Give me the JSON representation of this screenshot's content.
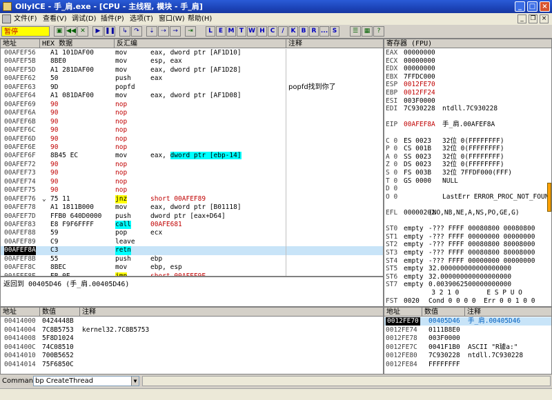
{
  "window": {
    "title": "OllyICE - 手_肩.exe - [CPU - 主线程, 模块 - 手_肩]"
  },
  "menu": [
    "文件(F)",
    "查看(V)",
    "调试(D)",
    "插件(P)",
    "选项(T)",
    "窗口(W)",
    "帮助(H)"
  ],
  "toolbar": {
    "status": "暂停",
    "letters": [
      "L",
      "E",
      "M",
      "T",
      "W",
      "H",
      "C",
      "/",
      "K",
      "B",
      "R",
      "...",
      "S"
    ]
  },
  "disasm": {
    "headers": [
      "地址",
      "HEX 数据",
      "反汇编",
      "注释"
    ],
    "rows": [
      {
        "addr": "00AFEF56",
        "hex": "A1 101DAF00",
        "mn": "mov",
        "op": "eax, dword ptr [AF1D10]",
        "cm": ""
      },
      {
        "addr": "00AFEF5B",
        "hex": "8BE0",
        "mn": "mov",
        "op": "esp, eax",
        "cm": ""
      },
      {
        "addr": "00AFEF5D",
        "hex": "A1 281DAF00",
        "mn": "mov",
        "op": "eax, dword ptr [AF1D28]",
        "cm": ""
      },
      {
        "addr": "00AFEF62",
        "hex": "50",
        "mn": "push",
        "op": "eax",
        "cm": ""
      },
      {
        "addr": "00AFEF63",
        "hex": "9D",
        "mn": "popfd",
        "op": "",
        "cm": "popfd找到你了"
      },
      {
        "addr": "00AFEF64",
        "hex": "A1 081DAF00",
        "mn": "mov",
        "op": "eax, dword ptr [AF1D08]",
        "cm": ""
      },
      {
        "addr": "00AFEF69",
        "hex": "90",
        "mn": "nop",
        "op": "",
        "cm": ""
      },
      {
        "addr": "00AFEF6A",
        "hex": "90",
        "mn": "nop",
        "op": "",
        "cm": ""
      },
      {
        "addr": "00AFEF6B",
        "hex": "90",
        "mn": "nop",
        "op": "",
        "cm": ""
      },
      {
        "addr": "00AFEF6C",
        "hex": "90",
        "mn": "nop",
        "op": "",
        "cm": ""
      },
      {
        "addr": "00AFEF6D",
        "hex": "90",
        "mn": "nop",
        "op": "",
        "cm": ""
      },
      {
        "addr": "00AFEF6E",
        "hex": "90",
        "mn": "nop",
        "op": "",
        "cm": ""
      },
      {
        "addr": "00AFEF6F",
        "hex": "8B45 EC",
        "mn": "mov",
        "op": "eax, ",
        "op_hl": "dword ptr [ebp-14]",
        "cm": ""
      },
      {
        "addr": "00AFEF72",
        "hex": "90",
        "mn": "nop",
        "op": "",
        "cm": ""
      },
      {
        "addr": "00AFEF73",
        "hex": "90",
        "mn": "nop",
        "op": "",
        "cm": ""
      },
      {
        "addr": "00AFEF74",
        "hex": "90",
        "mn": "nop",
        "op": "",
        "cm": ""
      },
      {
        "addr": "00AFEF75",
        "hex": "90",
        "mn": "nop",
        "op": "",
        "cm": ""
      },
      {
        "addr": "00AFEF76",
        "hex": "75 11",
        "mn": "jnz",
        "op": "short 00AFEF89",
        "cm": ""
      },
      {
        "addr": "00AFEF78",
        "hex": "A1 1811B000",
        "mn": "mov",
        "op": "eax, dword ptr [B01118]",
        "cm": ""
      },
      {
        "addr": "00AFEF7D",
        "hex": "FFB0 640D0000",
        "mn": "push",
        "op": "dword ptr [eax+D64]",
        "cm": ""
      },
      {
        "addr": "00AFEF83",
        "hex": "E8 F9F6FFFF",
        "mn": "call",
        "op": "00AFE681",
        "cm": ""
      },
      {
        "addr": "00AFEF88",
        "hex": "59",
        "mn": "pop",
        "op": "ecx",
        "cm": ""
      },
      {
        "addr": "00AFEF89",
        "hex": "C9",
        "mn": "leave",
        "op": "",
        "cm": ""
      },
      {
        "addr": "00AFEF8A",
        "hex": "C3",
        "mn": "retn",
        "op": "",
        "cm": ""
      },
      {
        "addr": "00AFEF8B",
        "hex": "55",
        "mn": "push",
        "op": "ebp",
        "cm": ""
      },
      {
        "addr": "00AFEF8C",
        "hex": "8BEC",
        "mn": "mov",
        "op": "ebp, esp",
        "cm": ""
      },
      {
        "addr": "00AFEF8E",
        "hex": "EB 0E",
        "mn": "jmp",
        "op": "short 00AFEF9E",
        "cm": ""
      }
    ]
  },
  "info": {
    "text": "返回到 00405D46 (手_肩.00405D46)"
  },
  "registers": {
    "title": "寄存器 (FPU)",
    "lines": [
      {
        "n": "EAX",
        "v": "00000000",
        "t": ""
      },
      {
        "n": "ECX",
        "v": "00000000",
        "t": ""
      },
      {
        "n": "EDX",
        "v": "00000000",
        "t": ""
      },
      {
        "n": "EBX",
        "v": "7FFDC000",
        "t": ""
      },
      {
        "n": "ESP",
        "v": "0012FE70",
        "t": "",
        "red": true
      },
      {
        "n": "EBP",
        "v": "0012FF24",
        "t": "",
        "red": true
      },
      {
        "n": "ESI",
        "v": "003F0000",
        "t": ""
      },
      {
        "n": "EDI",
        "v": "7C930228",
        "t": "ntdll.7C930228"
      },
      {
        "n": "",
        "v": "",
        "t": ""
      },
      {
        "n": "EIP",
        "v": "00AFEF8A",
        "t": "手_肩.00AFEF8A",
        "red": true
      },
      {
        "n": "",
        "v": "",
        "t": ""
      },
      {
        "n": "C 0",
        "v": "ES 0023",
        "t": "32位 0(FFFFFFFF)"
      },
      {
        "n": "P 0",
        "v": "CS 001B",
        "t": "32位 0(FFFFFFFF)"
      },
      {
        "n": "A 0",
        "v": "SS 0023",
        "t": "32位 0(FFFFFFFF)"
      },
      {
        "n": "Z 0",
        "v": "DS 0023",
        "t": "32位 0(FFFFFFFF)"
      },
      {
        "n": "S 0",
        "v": "FS 003B",
        "t": "32位 7FFDF000(FFF)"
      },
      {
        "n": "T 0",
        "v": "GS 0000",
        "t": "NULL"
      },
      {
        "n": "D 0",
        "v": "",
        "t": ""
      },
      {
        "n": "O 0",
        "v": "",
        "t": "LastErr ERROR_PROC_NOT_FOUND (00"
      },
      {
        "n": "",
        "v": "",
        "t": ""
      },
      {
        "n": "EFL",
        "v": "00000202",
        "t": "(NO,NB,NE,A,NS,PO,GE,G)"
      },
      {
        "n": "",
        "v": "",
        "t": ""
      },
      {
        "n": "ST0",
        "v": "empty",
        "t": "-??? FFFF 00080800 00080800"
      },
      {
        "n": "ST1",
        "v": "empty",
        "t": "-??? FFFF 00000000 00000000"
      },
      {
        "n": "ST2",
        "v": "empty",
        "t": "-??? FFFF 00080800 80008000"
      },
      {
        "n": "ST3",
        "v": "empty",
        "t": "-??? FFFF 00080800 80008000"
      },
      {
        "n": "ST4",
        "v": "empty",
        "t": "-??? FFFF 00000000 00000000"
      },
      {
        "n": "ST5",
        "v": "empty",
        "t": "32.000000000000000000"
      },
      {
        "n": "ST6",
        "v": "empty",
        "t": "32.000000000000000000"
      },
      {
        "n": "ST7",
        "v": "empty",
        "t": "0.0039062500000000000"
      },
      {
        "n": "",
        "v": "",
        "t": "      3 2 1 0       E S P U O"
      },
      {
        "n": "FST",
        "v": "0020",
        "t": "Cond 0 0 0 0  Err 0 0 1 0 0"
      }
    ]
  },
  "dump": {
    "headers": [
      "地址",
      "数值",
      "注释"
    ],
    "rows": [
      {
        "addr": "00414000",
        "val": "0424448B",
        "cm": ""
      },
      {
        "addr": "00414004",
        "val": "7C8B5753",
        "cm": "kernel32.7C8B5753"
      },
      {
        "addr": "00414008",
        "val": "5F8D1024",
        "cm": ""
      },
      {
        "addr": "0041400C",
        "val": "74C08510",
        "cm": ""
      },
      {
        "addr": "00414010",
        "val": "700B5652",
        "cm": ""
      },
      {
        "addr": "00414014",
        "val": "75F6850C",
        "cm": ""
      }
    ]
  },
  "stack": {
    "headers": [
      "地址",
      "数值",
      "注释"
    ],
    "rows": [
      {
        "addr": "0012FE70",
        "val": "00405D46",
        "cm": "手_肩.00405D46",
        "sel": true
      },
      {
        "addr": "0012FE74",
        "val": "0111B8E0",
        "cm": ""
      },
      {
        "addr": "0012FE78",
        "val": "003F0000",
        "cm": ""
      },
      {
        "addr": "0012FE7C",
        "val": "0041F1B0",
        "cm": "ASCII \"R璩a:\""
      },
      {
        "addr": "0012FE80",
        "val": "7C930228",
        "cm": "ntdll.7C930228"
      },
      {
        "addr": "0012FE84",
        "val": "FFFFFFFF",
        "cm": ""
      }
    ]
  },
  "command": {
    "label": "Command",
    "value": "bp CreateThread"
  }
}
